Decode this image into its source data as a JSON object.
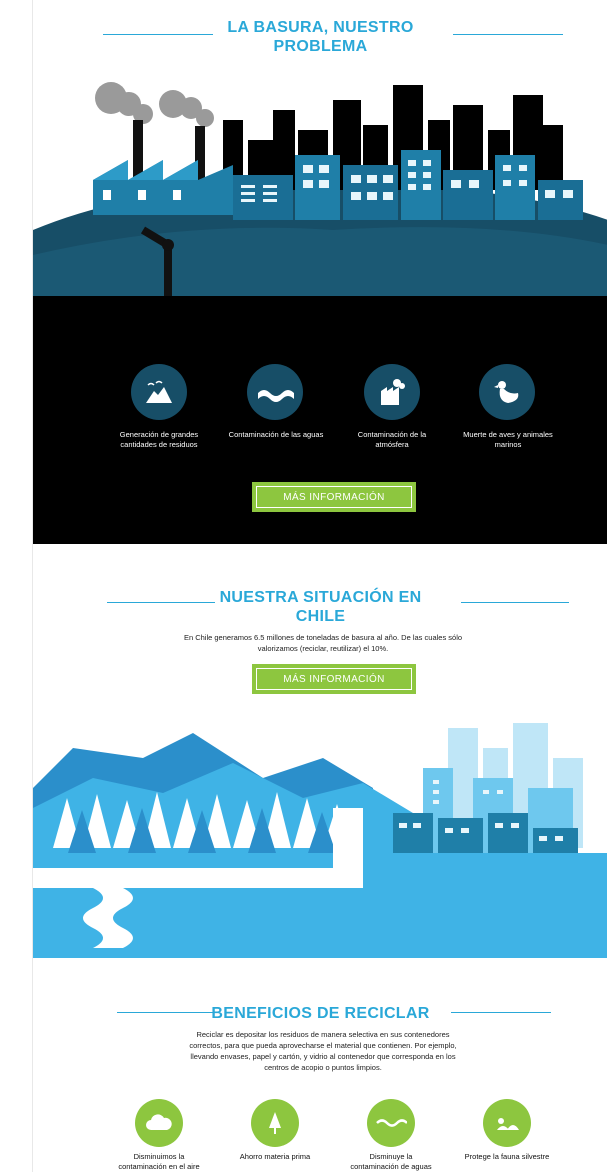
{
  "section1": {
    "title_line1": "LA BASURA, NUESTRO",
    "title_line2": "PROBLEMA",
    "icons": [
      {
        "icon": "cloud-mountain-icon",
        "caption_line1": "Generación de grandes",
        "caption_line2": "cantidades de residuos"
      },
      {
        "icon": "water-waves-icon",
        "caption_line1": "Contaminación de las aguas",
        "caption_line2": ""
      },
      {
        "icon": "factory-smoke-icon",
        "caption_line1": "Contaminación de la",
        "caption_line2": "atmósfera"
      },
      {
        "icon": "duck-icon",
        "caption_line1": "Muerte de aves y animales",
        "caption_line2": "marinos"
      }
    ],
    "button_label": "MÁS INFORMACIÓN"
  },
  "section2": {
    "title_line1": "NUESTRA SITUACIÓN EN",
    "title_line2": "CHILE",
    "text_line1": "En Chile generamos 6.5 millones de toneladas de basura al año. De las cuales sólo",
    "text_line2": "valorizamos (reciclar, reutilizar) el 10%.",
    "button_label": "MÁS INFORMACIÓN"
  },
  "section3": {
    "title": "BENEFICIOS DE RECICLAR",
    "text_line1": "Reciclar es depositar los residuos de manera selectiva en sus contenedores",
    "text_line2": "correctos, para que pueda aprovecharse el material que contienen. Por ejemplo,",
    "text_line3": "llevando envases, papel y cartón, y vidrio al contenedor que corresponda en los",
    "text_line4": "centros de acopio o puntos limpios.",
    "icons": [
      {
        "icon": "cloud-icon",
        "caption_line1": "Disminuimos la",
        "caption_line2": "contaminación en el aire"
      },
      {
        "icon": "tree-icon",
        "caption_line1": "Ahorro materia prima",
        "caption_line2": ""
      },
      {
        "icon": "waves-icon",
        "caption_line1": "Disminuye la",
        "caption_line2": "contaminación de aguas"
      },
      {
        "icon": "bird-icon",
        "caption_line1": "Protege la fauna silvestre",
        "caption_line2": ""
      }
    ]
  },
  "colors": {
    "accent_blue": "#2aa8d8",
    "dark_teal": "#174e67",
    "green": "#8dc63f",
    "sky": "#3fb3e6"
  }
}
